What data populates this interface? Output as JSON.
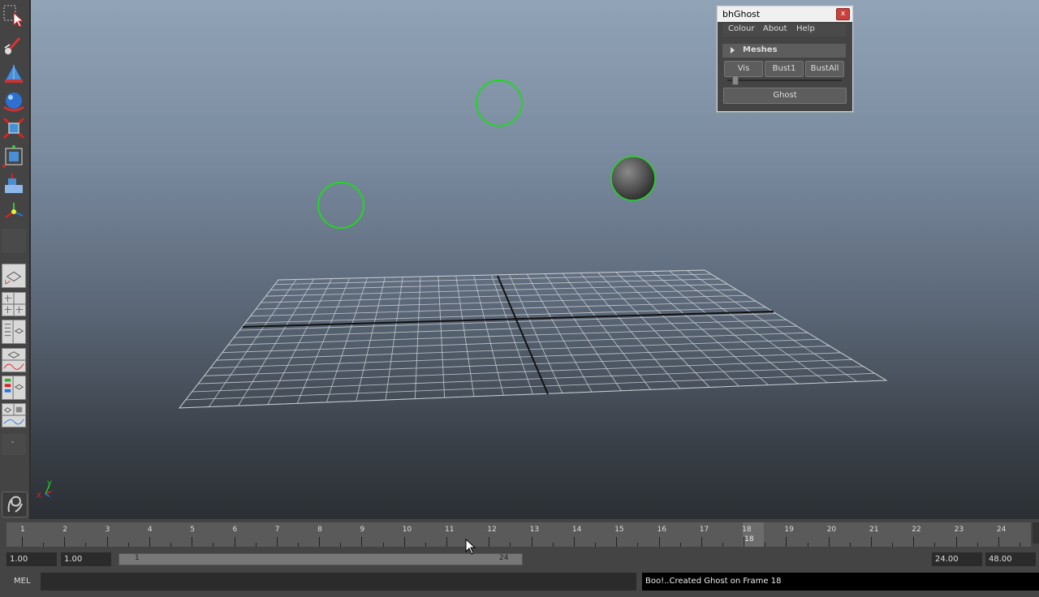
{
  "ghost_window": {
    "title": "bhGhost",
    "close_glyph": "x",
    "menu": [
      "Colour",
      "About",
      "Help"
    ],
    "section_label": "Meshes",
    "buttons": [
      "Vis",
      "Bust1",
      "BustAll"
    ],
    "ghost_button": "Ghost",
    "slider_value": 0.02
  },
  "viewport": {
    "axis_x": "x",
    "axis_y": "y"
  },
  "timeline": {
    "ticks": [
      "1",
      "2",
      "3",
      "4",
      "5",
      "6",
      "7",
      "8",
      "9",
      "10",
      "11",
      "12",
      "13",
      "14",
      "15",
      "16",
      "17",
      "18",
      "19",
      "20",
      "21",
      "22",
      "23",
      "24"
    ],
    "current_frame": "18"
  },
  "range": {
    "start_time": "1.00",
    "playback_start": "1.00",
    "slider_start": "1",
    "slider_end": "24",
    "playback_end": "24.00",
    "end_time": "48.00"
  },
  "command_line": {
    "label": "MEL",
    "input_value": "",
    "result": "Boo!..Created Ghost on Frame 18"
  },
  "colors": {
    "ghost_outline": "#1fd81f",
    "grid_line": "#c8ccd2",
    "close_button": "#c9413a"
  },
  "icons": [
    "select-tool-icon",
    "paint-select-icon",
    "polygon-cone-icon",
    "sphere-icon",
    "move-tool-icon",
    "scale-tool-icon",
    "soft-mod-icon",
    "manipulator-icon",
    "layout-single-icon",
    "layout-four-icon",
    "layout-outliner-icon",
    "layout-graph-icon",
    "layout-grid-icon",
    "layout-multi-icon",
    "expand-icon",
    "maya-logo-icon"
  ]
}
